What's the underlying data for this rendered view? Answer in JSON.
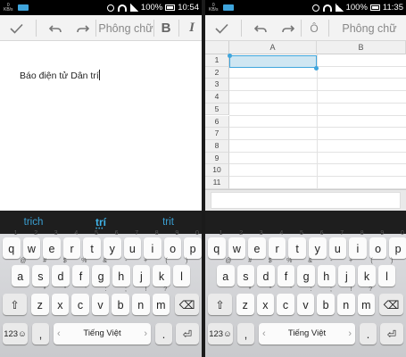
{
  "left": {
    "status": {
      "speed_top": "0",
      "speed_unit": "KB/s",
      "battery_pct": "100%",
      "time": "10:54"
    },
    "toolbar": {
      "font_label": "Phông chữ",
      "bold_label": "B",
      "italic_label": "I"
    },
    "doc_text": "Báo điện tử Dân trí",
    "suggestions": [
      "trich",
      "trí",
      "trit"
    ],
    "suggestion_dots": "•••",
    "keyboard": {
      "row1": [
        [
          "q",
          "1"
        ],
        [
          "w",
          "2"
        ],
        [
          "e",
          "3"
        ],
        [
          "r",
          "4"
        ],
        [
          "t",
          "5"
        ],
        [
          "y",
          "6"
        ],
        [
          "u",
          "7"
        ],
        [
          "i",
          "8"
        ],
        [
          "o",
          "9"
        ],
        [
          "p",
          "0"
        ]
      ],
      "row2": [
        [
          "a",
          "@"
        ],
        [
          "s",
          "#"
        ],
        [
          "d",
          "$"
        ],
        [
          "f",
          "%"
        ],
        [
          "g",
          "&"
        ],
        [
          "h",
          "-"
        ],
        [
          "j",
          "+"
        ],
        [
          "k",
          "("
        ],
        [
          "l",
          ")"
        ]
      ],
      "row3": [
        [
          "z",
          "*"
        ],
        [
          "x",
          "\""
        ],
        [
          "c",
          "'"
        ],
        [
          "v",
          ":"
        ],
        [
          "b",
          ";"
        ],
        [
          "n",
          "!"
        ],
        [
          "m",
          "?"
        ]
      ],
      "mode_label": "123☺",
      "comma": ",",
      "space_label": "Tiếng Việt",
      "period": ".",
      "shift_icon": "⇧",
      "delete_icon": "⌫",
      "enter_icon": "⏎"
    }
  },
  "right": {
    "status": {
      "speed_top": "0",
      "speed_unit": "KB/s",
      "battery_pct": "100%",
      "time": "11:35"
    },
    "toolbar": {
      "font_label": "Phông chữ",
      "o_label": "Ô"
    },
    "columns": [
      "A",
      "B"
    ],
    "rows": [
      "1",
      "2",
      "3",
      "4",
      "5",
      "6",
      "7",
      "8",
      "9",
      "10",
      "11"
    ],
    "selected_cell": "A1",
    "keyboard": {
      "row1": [
        [
          "q",
          "1"
        ],
        [
          "w",
          "2"
        ],
        [
          "e",
          "3"
        ],
        [
          "r",
          "4"
        ],
        [
          "t",
          "5"
        ],
        [
          "y",
          "6"
        ],
        [
          "u",
          "7"
        ],
        [
          "i",
          "8"
        ],
        [
          "o",
          "9"
        ],
        [
          "p",
          "0"
        ]
      ],
      "row2": [
        [
          "a",
          "@"
        ],
        [
          "s",
          "#"
        ],
        [
          "d",
          "$"
        ],
        [
          "f",
          "%"
        ],
        [
          "g",
          "&"
        ],
        [
          "h",
          "-"
        ],
        [
          "j",
          "+"
        ],
        [
          "k",
          "("
        ],
        [
          "l",
          ")"
        ]
      ],
      "row3": [
        [
          "z",
          "*"
        ],
        [
          "x",
          "\""
        ],
        [
          "c",
          "'"
        ],
        [
          "v",
          ":"
        ],
        [
          "b",
          ";"
        ],
        [
          "n",
          "!"
        ],
        [
          "m",
          "?"
        ]
      ],
      "mode_label": "123☺",
      "comma": ",",
      "space_label": "Tiếng Việt",
      "period": ".",
      "shift_icon": "⇧",
      "delete_icon": "⌫",
      "enter_icon": "⏎"
    }
  },
  "colors": {
    "accent": "#3fa5dc",
    "suggestion_bar": "#1e1e1e",
    "selection_fill": "#cfe6f2"
  }
}
